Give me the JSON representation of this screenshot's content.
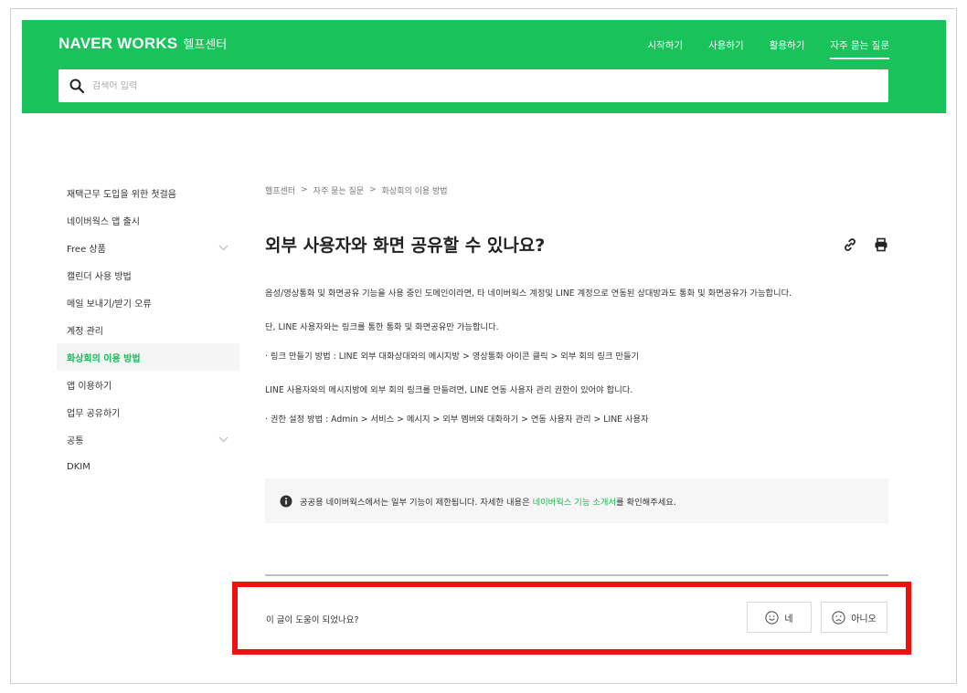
{
  "header": {
    "logo_main": "NAVER WORKS",
    "logo_sub": "헬프센터",
    "nav": [
      "시작하기",
      "사용하기",
      "활용하기",
      "자주 묻는 질문"
    ],
    "search_placeholder": "검색어 입력"
  },
  "sidebar": {
    "items": [
      {
        "label": "재택근무 도입을 위한 첫걸음"
      },
      {
        "label": "네이버웍스 앱 출시"
      },
      {
        "label": "Free 상품"
      },
      {
        "label": "캘린더 사용 방법"
      },
      {
        "label": "메일 보내기/받기 오류"
      },
      {
        "label": "계정 관리"
      },
      {
        "label": "화상회의 이용 방법"
      },
      {
        "label": "앱 이용하기"
      },
      {
        "label": "업무 공유하기"
      },
      {
        "label": "공통"
      },
      {
        "label": "DKIM"
      }
    ]
  },
  "main": {
    "breadcrumb": [
      "헬프센터",
      "자주 묻는 질문",
      "화상회의 이용 방법"
    ],
    "breadcrumb_sep": ">",
    "title": "외부 사용자와 화면 공유할 수 있나요?",
    "paragraphs": [
      "음성/영상통화 및 화면공유 기능을 사용 중인 도메인이라면, 타 네이버웍스 계정및 LINE 계정으로 연동된 상대방과도 통화 및 화면공유가 가능합니다.",
      "단, LINE 사용자와는 링크를 통한 통화 및 화면공유만 가능합니다.",
      "· 링크 만들기 방법 : LINE 외부 대화상대와의 메시지방 > 영상통화 아이콘 클릭 > 외부 회의 링크 만들기",
      "LINE 사용자와의 메시지방에 외부 회의 링크를 만들려면, LINE 연동 사용자 관리 권한이 있어야 합니다.",
      "· 권한 설정 방법 : Admin > 서비스 > 메시지 > 외부 멤버와 대화하기 > 연동 사용자 관리 > LINE 사용자"
    ],
    "notice_before": "공공용 네이버웍스에서는 일부 기능이 제한됩니다. 자세한 내용은 ",
    "notice_link": "네이버웍스 기능 소개서",
    "notice_after": "를 확인해주세요."
  },
  "feedback": {
    "question": "이 글이 도움이 되었나요?",
    "yes_label": "네",
    "no_label": "아니오"
  },
  "colors": {
    "brand_green": "#19c25a",
    "active_green": "#19b955",
    "highlight_red": "#ee1111"
  }
}
